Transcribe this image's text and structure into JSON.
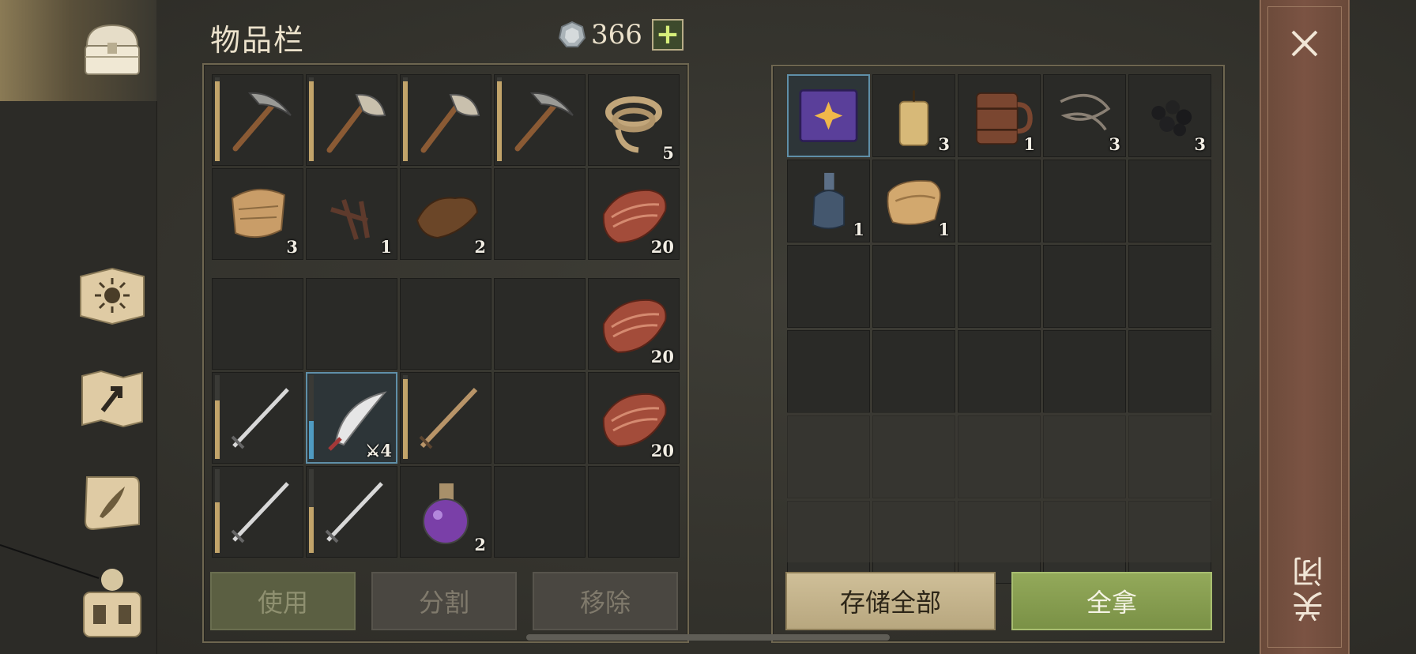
{
  "inventory": {
    "title": "物品栏",
    "currency_amount": "366",
    "currency_plus": "+",
    "equipment_rows": [
      [
        {
          "icon": "pickaxe-icon",
          "count": "",
          "durability": 0.95
        },
        {
          "icon": "axe-icon",
          "count": "",
          "durability": 0.95
        },
        {
          "icon": "axe-icon",
          "count": "",
          "durability": 0.95
        },
        {
          "icon": "pickaxe-icon",
          "count": "",
          "durability": 0.95
        },
        {
          "icon": "rope-icon",
          "count": "5"
        }
      ],
      [
        {
          "icon": "fiber-cloth-icon",
          "count": "3"
        },
        {
          "icon": "nails-icon",
          "count": "1"
        },
        {
          "icon": "leather-icon",
          "count": "2"
        },
        {
          "icon": "",
          "count": ""
        },
        {
          "icon": "raw-meat-icon",
          "count": "20"
        }
      ]
    ],
    "backpack_rows": [
      [
        {
          "icon": "",
          "count": ""
        },
        {
          "icon": "",
          "count": ""
        },
        {
          "icon": "",
          "count": ""
        },
        {
          "icon": "",
          "count": ""
        },
        {
          "icon": "raw-meat-icon",
          "count": "20"
        }
      ],
      [
        {
          "icon": "sword-icon",
          "count": "",
          "durability": 0.7
        },
        {
          "icon": "scimitar-icon",
          "count": "4",
          "durability": 0.45,
          "selected": true
        },
        {
          "icon": "wooden-sword-icon",
          "count": "",
          "durability": 0.95
        },
        {
          "icon": "",
          "count": ""
        },
        {
          "icon": "raw-meat-icon",
          "count": "20"
        }
      ],
      [
        {
          "icon": "sword-icon",
          "count": "",
          "durability": 0.6
        },
        {
          "icon": "sword-icon",
          "count": "",
          "durability": 0.55
        },
        {
          "icon": "potion-icon",
          "count": "2"
        },
        {
          "icon": "",
          "count": ""
        },
        {
          "icon": "",
          "count": ""
        }
      ]
    ],
    "buttons": {
      "use": "使用",
      "split": "分割",
      "remove": "移除"
    }
  },
  "storage": {
    "rows": [
      [
        {
          "icon": "spellbook-icon",
          "count": "",
          "selected": true
        },
        {
          "icon": "candle-icon",
          "count": "3"
        },
        {
          "icon": "tankard-icon",
          "count": "1"
        },
        {
          "icon": "wire-icon",
          "count": "3"
        },
        {
          "icon": "coal-icon",
          "count": "3"
        }
      ],
      [
        {
          "icon": "bottle-icon",
          "count": "1"
        },
        {
          "icon": "cloth-roll-icon",
          "count": "1"
        },
        {
          "icon": "",
          "count": ""
        },
        {
          "icon": "",
          "count": ""
        },
        {
          "icon": "",
          "count": ""
        }
      ],
      [
        {
          "icon": ""
        },
        {
          "icon": ""
        },
        {
          "icon": ""
        },
        {
          "icon": ""
        },
        {
          "icon": ""
        }
      ],
      [
        {
          "icon": ""
        },
        {
          "icon": ""
        },
        {
          "icon": ""
        },
        {
          "icon": ""
        },
        {
          "icon": ""
        }
      ],
      [
        {
          "icon": ""
        },
        {
          "icon": ""
        },
        {
          "icon": ""
        },
        {
          "icon": ""
        },
        {
          "icon": ""
        }
      ],
      [
        {
          "icon": ""
        },
        {
          "icon": ""
        },
        {
          "icon": ""
        },
        {
          "icon": ""
        },
        {
          "icon": ""
        }
      ]
    ],
    "buttons": {
      "store_all": "存储全部",
      "take_all": "全拿"
    }
  },
  "close_panel": {
    "label": "关闭"
  },
  "sidebar": {
    "icons": [
      "chest-icon",
      "sun-book-icon",
      "map-icon",
      "scroll-quill-icon",
      "backpack-icon"
    ]
  }
}
